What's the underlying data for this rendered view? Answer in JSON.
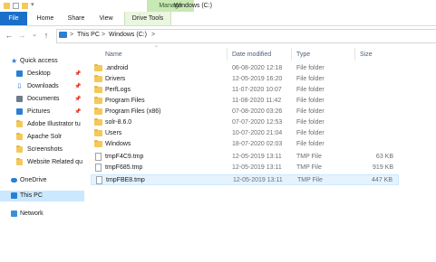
{
  "window": {
    "title": "Windows (C:)",
    "manage_label": "Manage"
  },
  "ribbon": {
    "tabs": [
      "File",
      "Home",
      "Share",
      "View",
      "Drive Tools"
    ]
  },
  "address": {
    "crumbs": [
      "This PC",
      "Windows (C:)"
    ],
    "separator": ">"
  },
  "nav": {
    "quick_access": "Quick access",
    "items": [
      {
        "label": "Desktop",
        "icon": "desktop-icon"
      },
      {
        "label": "Downloads",
        "icon": "download-icon"
      },
      {
        "label": "Documents",
        "icon": "documents-icon"
      },
      {
        "label": "Pictures",
        "icon": "pictures-icon"
      },
      {
        "label": "Adobe Illustrator tu",
        "icon": "folder-icon"
      },
      {
        "label": "Apache Solr",
        "icon": "folder-icon"
      },
      {
        "label": "Screenshots",
        "icon": "folder-icon"
      },
      {
        "label": "Website Related qu",
        "icon": "folder-icon"
      }
    ],
    "onedrive": "OneDrive",
    "this_pc": "This PC",
    "network": "Network"
  },
  "columns": {
    "name": "Name",
    "date": "Date modified",
    "type": "Type",
    "size": "Size"
  },
  "files": [
    {
      "name": ".android",
      "date": "06-08-2020 12:18",
      "type": "File folder",
      "size": "",
      "kind": "folder"
    },
    {
      "name": "Drivers",
      "date": "12-05-2019 16:20",
      "type": "File folder",
      "size": "",
      "kind": "folder"
    },
    {
      "name": "PerfLogs",
      "date": "11-07-2020 10:07",
      "type": "File folder",
      "size": "",
      "kind": "folder"
    },
    {
      "name": "Program Files",
      "date": "11-08-2020 11:42",
      "type": "File folder",
      "size": "",
      "kind": "folder"
    },
    {
      "name": "Program Files (x86)",
      "date": "07-08-2020 03:26",
      "type": "File folder",
      "size": "",
      "kind": "folder"
    },
    {
      "name": "solr-8.6.0",
      "date": "07-07-2020 12:53",
      "type": "File folder",
      "size": "",
      "kind": "folder"
    },
    {
      "name": "Users",
      "date": "10-07-2020 21:04",
      "type": "File folder",
      "size": "",
      "kind": "folder"
    },
    {
      "name": "Windows",
      "date": "18-07-2020 02:03",
      "type": "File folder",
      "size": "",
      "kind": "folder"
    },
    {
      "name": "tmpF4C9.tmp",
      "date": "12-05-2019 13:11",
      "type": "TMP File",
      "size": "63 KB",
      "kind": "file"
    },
    {
      "name": "tmpF685.tmp",
      "date": "12-05-2019 13:11",
      "type": "TMP File",
      "size": "919 KB",
      "kind": "file"
    },
    {
      "name": "tmpFBE8.tmp",
      "date": "12-05-2019 13:11",
      "type": "TMP File",
      "size": "447 KB",
      "kind": "file",
      "selected": true
    }
  ]
}
